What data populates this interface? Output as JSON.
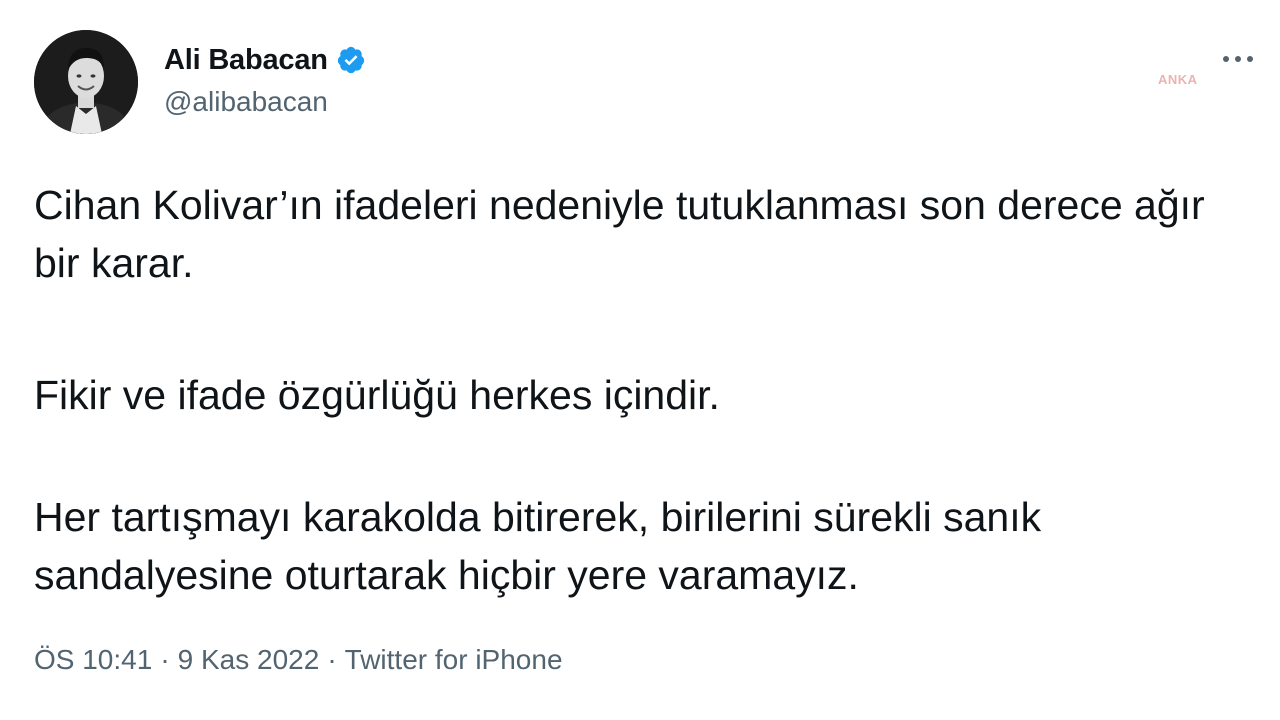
{
  "user": {
    "display_name": "Ali Babacan",
    "handle": "@alibabacan",
    "verified_icon": "verified-badge-icon",
    "avatar": "avatar"
  },
  "tweet": {
    "paragraphs": [
      "Cihan Kolivar’ın ifadeleri nedeniyle tutuklanması son derece ağır bir karar.",
      "Fikir ve ifade özgürlüğü herkes içindir.",
      "Her tartışmayı karakolda bitirerek, birilerini sürekli sanık sandalyesine oturtarak hiçbir yere varamayız."
    ]
  },
  "meta": {
    "time": "ÖS 10:41",
    "separator": "·",
    "date": "9 Kas 2022",
    "source": "Twitter for iPhone"
  },
  "watermark": "ANKA",
  "colors": {
    "text": "#0f1419",
    "secondary": "#536471",
    "verified": "#1d9bf0",
    "background": "#ffffff"
  }
}
